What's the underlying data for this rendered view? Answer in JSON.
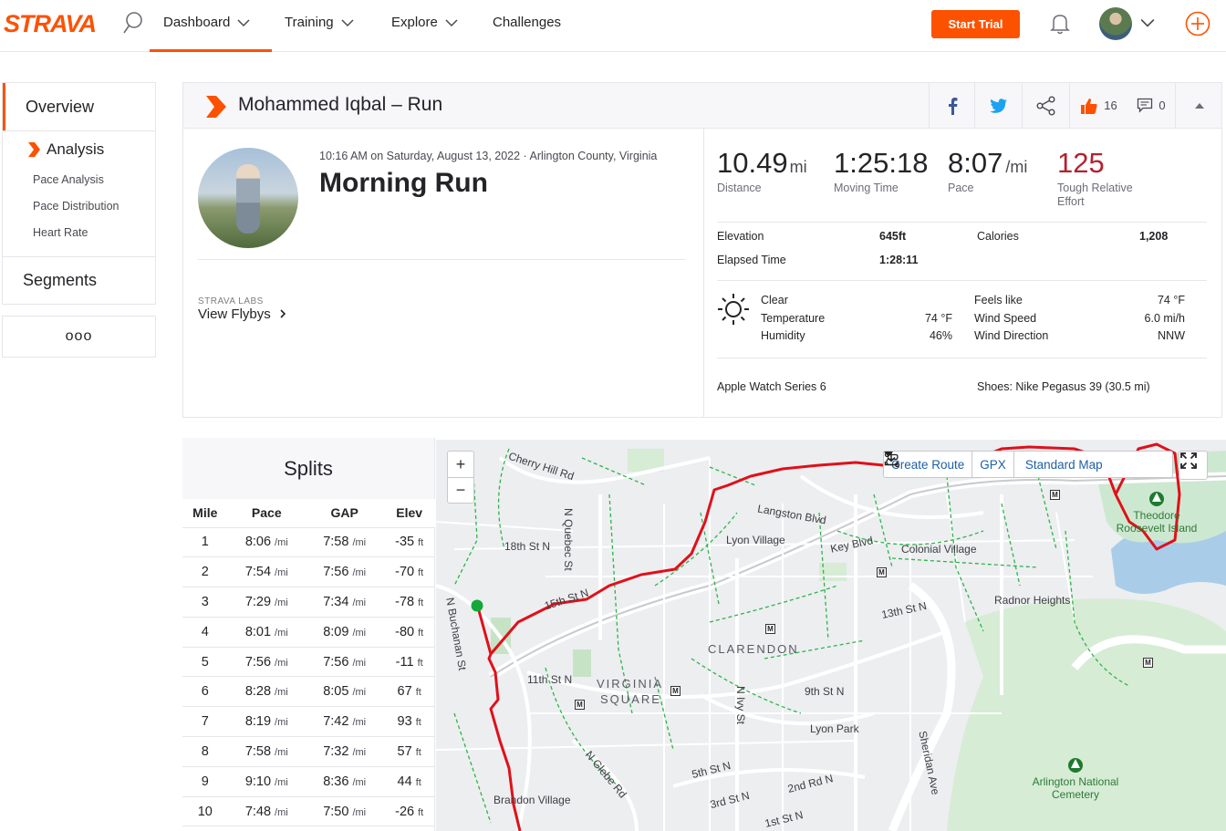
{
  "nav": {
    "logo": "STRAVA",
    "items": [
      {
        "label": "Dashboard"
      },
      {
        "label": "Training"
      },
      {
        "label": "Explore"
      },
      {
        "label": "Challenges"
      }
    ],
    "start_trial": "Start Trial",
    "accent": "#fc5200"
  },
  "sidebar": {
    "overview": "Overview",
    "analysis": "Analysis",
    "sub_items": [
      "Pace Analysis",
      "Pace Distribution",
      "Heart Rate"
    ],
    "segments": "Segments",
    "more": "ooo"
  },
  "activity": {
    "header_title": "Mohammed Iqbal – Run",
    "kudos_count": "16",
    "comment_count": "0",
    "meta": "10:16 AM on Saturday, August 13, 2022 · Arlington County, Virginia",
    "name": "Morning Run",
    "labs_label": "STRAVA LABS",
    "flybys": "View Flybys",
    "stats": {
      "distance_val": "10.49",
      "distance_unit": "mi",
      "distance_lbl": "Distance",
      "moving_val": "1:25:18",
      "moving_lbl": "Moving Time",
      "pace_val": "8:07",
      "pace_unit": "/mi",
      "pace_lbl": "Pace",
      "effort_val": "125",
      "effort_lbl_1": "Tough Relative",
      "effort_lbl_2": "Effort"
    },
    "details": {
      "elevation_lbl": "Elevation",
      "elevation_val": "645ft",
      "calories_lbl": "Calories",
      "calories_val": "1,208",
      "elapsed_lbl": "Elapsed Time",
      "elapsed_val": "1:28:11"
    },
    "weather": {
      "condition": "Clear",
      "temp_lbl": "Temperature",
      "temp_val": "74 °F",
      "humidity_lbl": "Humidity",
      "humidity_val": "46%",
      "feels_lbl": "Feels like",
      "feels_val": "74 °F",
      "wind_speed_lbl": "Wind Speed",
      "wind_speed_val": "6.0 mi/h",
      "wind_dir_lbl": "Wind Direction",
      "wind_dir_val": "NNW"
    },
    "device": "Apple Watch Series 6",
    "shoes": "Shoes: Nike Pegasus 39 (30.5 mi)"
  },
  "splits": {
    "title": "Splits",
    "headers": [
      "Mile",
      "Pace",
      "GAP",
      "Elev"
    ],
    "unit_pace": "/mi",
    "unit_elev": "ft",
    "rows": [
      [
        "1",
        "8:06",
        "7:58",
        "-35"
      ],
      [
        "2",
        "7:54",
        "7:56",
        "-70"
      ],
      [
        "3",
        "7:29",
        "7:34",
        "-78"
      ],
      [
        "4",
        "8:01",
        "8:09",
        "-80"
      ],
      [
        "5",
        "7:56",
        "7:56",
        "-11"
      ],
      [
        "6",
        "8:28",
        "8:05",
        "67"
      ],
      [
        "7",
        "8:19",
        "7:42",
        "93"
      ],
      [
        "8",
        "7:58",
        "7:32",
        "57"
      ],
      [
        "9",
        "9:10",
        "8:36",
        "44"
      ],
      [
        "10",
        "7:48",
        "7:50",
        "-26"
      ]
    ]
  },
  "map": {
    "zoom_in": "+",
    "zoom_out": "−",
    "create_route": "Create Route",
    "gpx": "GPX",
    "map_type": "Standard Map",
    "labels": {
      "cherry": "Cherry Hill Rd",
      "quebec": "N Quebec St",
      "st18": "18th St N",
      "langston": "Langston Blvd",
      "lyon_village": "Lyon Village",
      "key": "Key Blvd",
      "colonial": "Colonial Village",
      "st15": "15th St N",
      "buchanan": "N Buchanan St",
      "st13": "13th St N",
      "radnor": "Radnor Heights",
      "clarendon": "CLARENDON",
      "st11": "11th St N",
      "virginia_1": "VIRGINIA",
      "virginia_2": "SQUARE",
      "ivy": "N Ivy St",
      "st9": "9th St N",
      "lyon_park": "Lyon Park",
      "sheridan": "Sheridan Ave",
      "st5": "5th St N",
      "st2": "2nd Rd N",
      "glebe": "N Glebe Rd",
      "st3": "3rd St N",
      "st1": "1st St N",
      "brandon": "Brandon Village",
      "theodore_1": "Theodore",
      "theodore_2": "Roosevelt Island",
      "cemetery_1": "Arlington National",
      "cemetery_2": "Cemetery"
    },
    "route_color": "#e0101a",
    "trail_color": "#2fb34a"
  }
}
